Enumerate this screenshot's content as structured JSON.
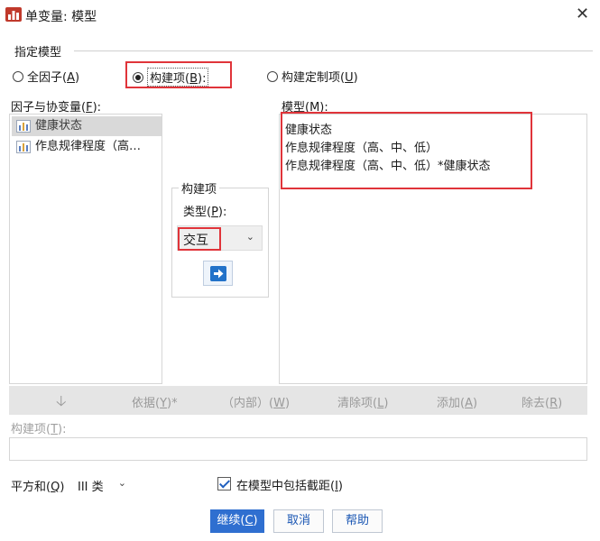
{
  "window": {
    "title": "单变量: 模型",
    "app_icon": "spss-chart-icon",
    "close_icon": "close-icon"
  },
  "specify_model": {
    "group_label": "指定模型",
    "radio_full_factorial": {
      "prefix": "全因子(",
      "mnemonic": "A",
      "suffix": ")",
      "selected": false
    },
    "radio_build_terms": {
      "prefix": "构建项(",
      "mnemonic": "B",
      "suffix": "):",
      "selected": true
    },
    "radio_build_custom": {
      "prefix": "构建定制项(",
      "mnemonic": "U",
      "suffix": ")",
      "selected": false
    }
  },
  "factors": {
    "label_prefix": "因子与协变量(",
    "label_mnemonic": "F",
    "label_suffix": "):",
    "items": [
      {
        "label": "健康状态",
        "icon": "nominal-variable-icon",
        "selected": true
      },
      {
        "label": "作息规律程度（高…",
        "icon": "nominal-variable-icon",
        "selected": false
      }
    ]
  },
  "build_term": {
    "group_label": "构建项",
    "type_label_prefix": "类型(",
    "type_label_mnemonic": "P",
    "type_label_suffix": "):",
    "type_value": "交互",
    "move_button_icon": "arrow-right-icon"
  },
  "model": {
    "label_prefix": "模型(",
    "label_mnemonic": "M",
    "label_suffix": "):",
    "items": [
      "健康状态",
      "作息规律程度（高、中、低）",
      "作息规律程度（高、中、低）*健康状态"
    ]
  },
  "term_toolbar": {
    "down_arrow_icon": "arrow-down-icon",
    "by": {
      "prefix": "依据(",
      "mnemonic": "Y",
      "suffix": ")*"
    },
    "within": {
      "prefix": "（内部）(",
      "mnemonic": "W",
      "suffix": ")"
    },
    "clear": {
      "prefix": "清除项(",
      "mnemonic": "L",
      "suffix": ")"
    },
    "add": {
      "prefix": "添加(",
      "mnemonic": "A",
      "suffix": ")"
    },
    "remove": {
      "prefix": "除去(",
      "mnemonic": "R",
      "suffix": ")"
    }
  },
  "build_terms_field": {
    "label_prefix": "构建项(",
    "label_mnemonic": "T",
    "label_suffix": "):",
    "value": ""
  },
  "sum_of_squares": {
    "label_prefix": "平方和(",
    "label_mnemonic": "Q",
    "label_suffix": ")",
    "value": "III 类"
  },
  "include_intercept": {
    "label_prefix": "在模型中包括截距(",
    "label_mnemonic": "I",
    "label_suffix": ")",
    "checked": true
  },
  "buttons": {
    "continue": {
      "prefix": "继续(",
      "mnemonic": "C",
      "suffix": ")"
    },
    "cancel": "取消",
    "help": "帮助"
  }
}
